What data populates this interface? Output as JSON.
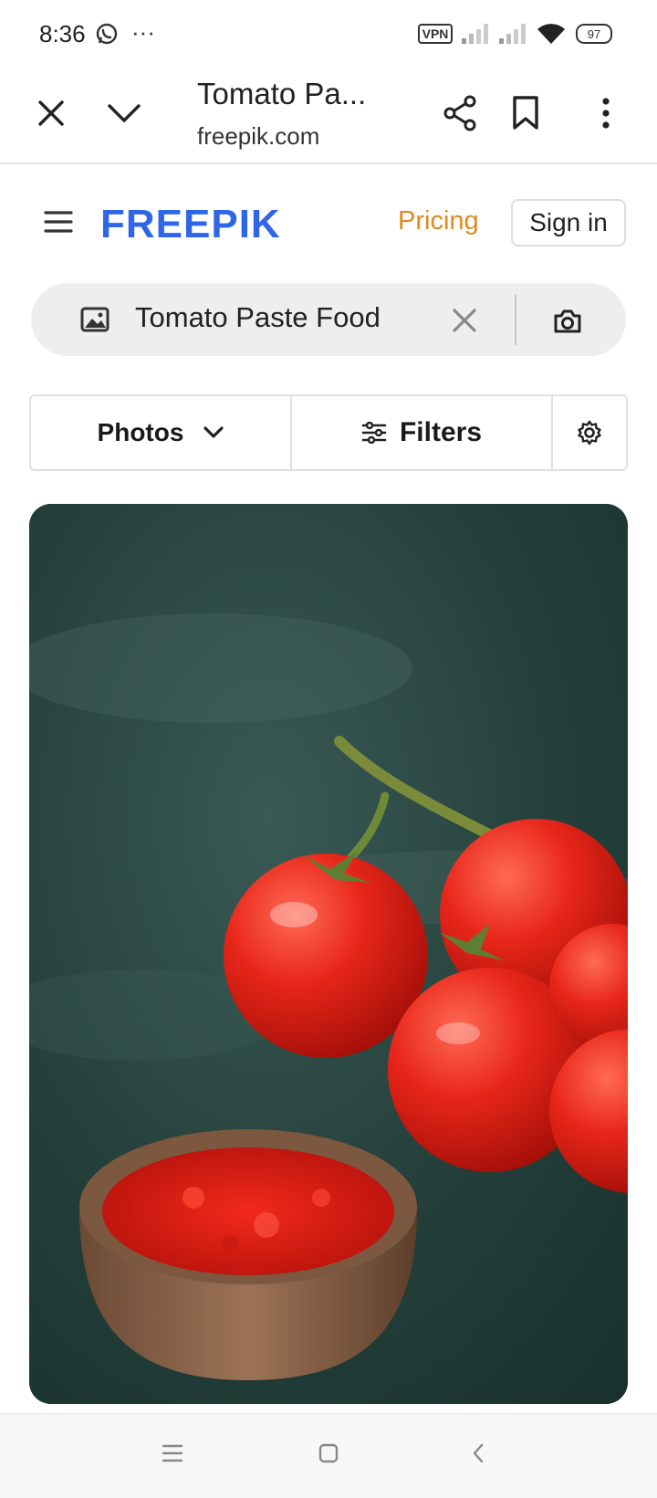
{
  "status_bar": {
    "time": "8:36",
    "more": "···",
    "vpn_label": "VPN",
    "battery": "97",
    "icons": [
      "whatsapp-icon",
      "vpn-icon",
      "signal-icon",
      "signal-icon",
      "wifi-icon",
      "battery-icon"
    ]
  },
  "browser": {
    "tab_title": "Tomato Pa...",
    "url": "freepik.com",
    "icons": [
      "close-icon",
      "chevron-down-icon",
      "share-icon",
      "bookmark-icon",
      "more-vertical-icon"
    ]
  },
  "site": {
    "logo": "FREEPIK",
    "pricing": "Pricing",
    "sign_in": "Sign in",
    "brand_color": "#2f66e8",
    "accent_color": "#e08a1e"
  },
  "search": {
    "value": "Tomato Paste Food",
    "icons": [
      "image-icon",
      "clear-icon",
      "camera-icon"
    ]
  },
  "filter_bar": {
    "type": "Photos",
    "filters": "Filters",
    "icons": [
      "chevron-down-icon",
      "sliders-icon",
      "settings-icon"
    ]
  },
  "result": {
    "image": "tomato-paste-photo"
  },
  "nav_bar": {
    "icons": [
      "menu-icon",
      "home-icon",
      "back-icon"
    ]
  }
}
